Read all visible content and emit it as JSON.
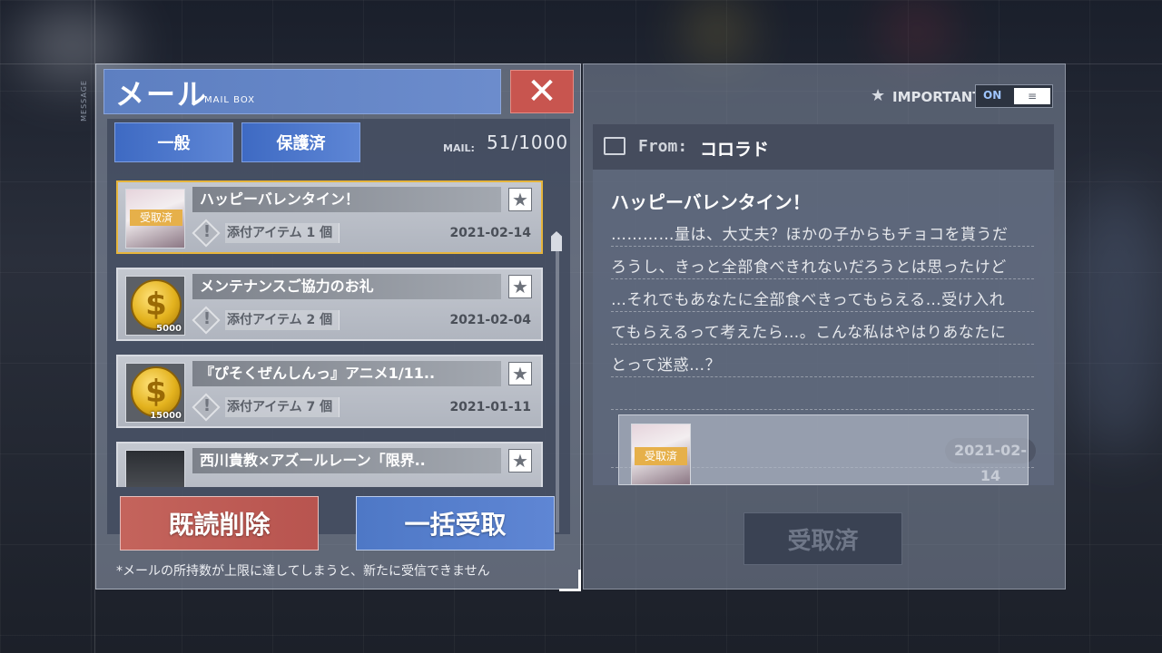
{
  "side_tag": "MESSAGE",
  "mailbox": {
    "title": "メール",
    "subtitle": "MAIL BOX",
    "close_label": "✕",
    "tabs": [
      {
        "label": "一般"
      },
      {
        "label": "保護済"
      }
    ],
    "count_label": "MAIL:",
    "count_value": "51/1000",
    "items": [
      {
        "title": "ハッピーバレンタイン！",
        "attachment": "添付アイテム 1 個",
        "date": "2021-02-14",
        "thumb": "character-avatar",
        "badge": "受取済"
      },
      {
        "title": "メンテナンスご協力のお礼",
        "attachment": "添付アイテム 2 個",
        "date": "2021-02-04",
        "thumb": "gold-coin",
        "qty": "5000"
      },
      {
        "title": "『ぴそくぜんしんっ』アニメ1/11..",
        "attachment": "添付アイテム 7 個",
        "date": "2021-01-11",
        "thumb": "gold-coin",
        "qty": "15000"
      },
      {
        "title": "西川貴教×アズールレーン「限界..",
        "thumb": "dark-item"
      }
    ],
    "delete_read_label": "既読削除",
    "receive_all_label": "一括受取",
    "footer_note": "*メールの所持数が上限に達してしまうと、新たに受信できません"
  },
  "detail": {
    "important_label": "IMPORTANT",
    "toggle_on_label": "ON",
    "toggle_knob_label": "≡",
    "from_label": "From:",
    "from_name": "コロラド",
    "title": "ハッピーバレンタイン！",
    "body_lines": [
      "…………量は、大丈夫？ほかの子からもチョコを貰うだ",
      "ろうし、きっと全部食べきれないだろうとは思ったけど",
      "…それでもあなたに全部食べきってもらえる…受け入れ",
      "てもらえるって考えたら…。こんな私はやはりあなたに",
      "とって迷惑…？"
    ],
    "date": "2021-02-14",
    "attachment_badge": "受取済",
    "received_button_label": "受取済"
  },
  "colors": {
    "accent_blue": "#4e78c6",
    "delete_red": "#c4645c",
    "close_red": "#c8554f",
    "selected_gold": "#e6b53c",
    "badge_gold": "#e6b04a"
  }
}
